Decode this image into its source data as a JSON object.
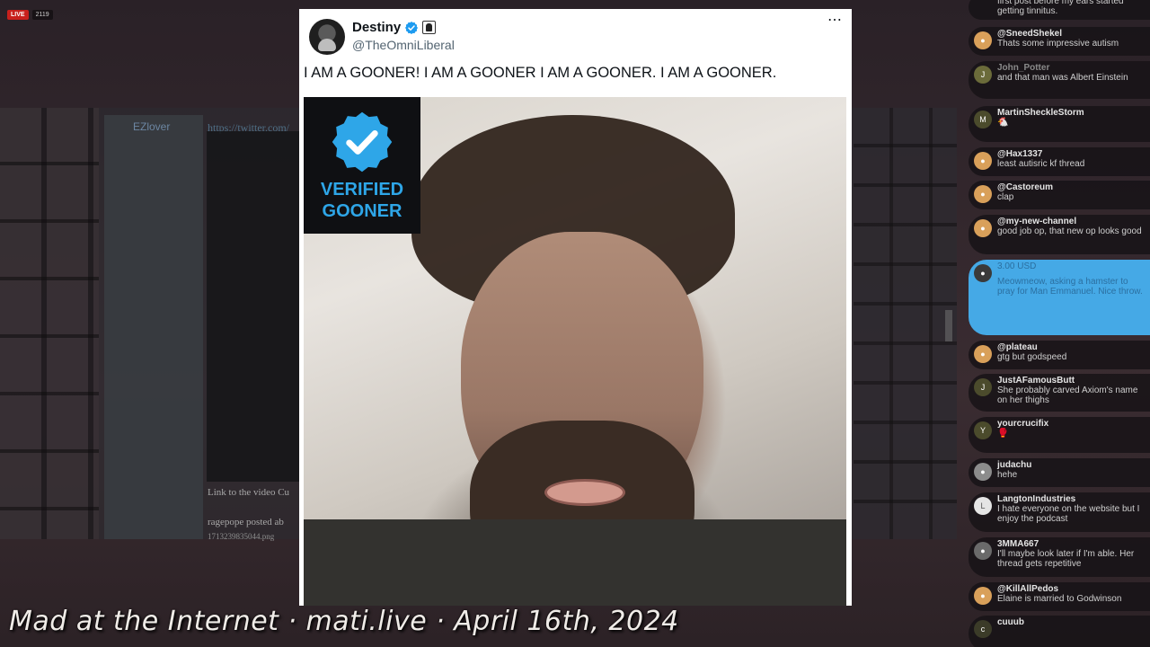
{
  "stream": {
    "live_label": "LIVE",
    "viewer_count": "2119",
    "watermark": "Mad at the Internet · mati.live · April 16th, 2024"
  },
  "background_page": {
    "sidebar_name": "EZlover",
    "url_text": "https://twitter.com/",
    "link_text": "Link to the video Cu",
    "post_text": "ragepope posted ab",
    "file_text": "1713239835044.png"
  },
  "tweet": {
    "display_name": "Destiny",
    "handle": "@TheOmniLiberal",
    "text": "I AM A GOONER! I AM A GOONER I AM A GOONER. I AM A GOONER.",
    "more_icon": "⋯",
    "badge_line1": "VERIFIED",
    "badge_line2": "GOONER",
    "verified_color": "#1d9bf0"
  },
  "chat": {
    "messages": [
      {
        "user": "",
        "body": "first post before my ears started getting tinnitus.",
        "avatar": ""
      },
      {
        "user": "@SneedShekel",
        "body": "Thats some impressive autism",
        "avatar": "●"
      },
      {
        "user": "John_Potter",
        "body": "and that man was Albert Einstein",
        "avatar": "J"
      },
      {
        "user": "MartinSheckleStorm",
        "body": "🐔",
        "avatar": "M"
      },
      {
        "user": "@Hax1337",
        "body": "least autisric kf thread",
        "avatar": "●"
      },
      {
        "user": "@Castoreum",
        "body": "clap",
        "avatar": "●"
      },
      {
        "user": "@my-new-channel",
        "body": "good job op, that new op looks good",
        "avatar": "●"
      },
      {
        "user": "",
        "body": "Meowmeow, asking a hamster to pray for Man Emmanuel. Nice throw.",
        "amount": "3.00 USD",
        "avatar": "●"
      },
      {
        "user": "@plateau",
        "body": "gtg but godspeed",
        "avatar": "●"
      },
      {
        "user": "JustAFamousButt",
        "body": "She probably carved Axiom's name on her thighs",
        "avatar": "J"
      },
      {
        "user": "yourcrucifix",
        "body": "🥊",
        "avatar": "Y"
      },
      {
        "user": "judachu",
        "body": "hehe",
        "avatar": "●"
      },
      {
        "user": "LangtonIndustries",
        "body": "I hate everyone on the website but I enjoy the podcast",
        "avatar": "L"
      },
      {
        "user": "3MMA667",
        "body": "I'll maybe look later if I'm able. Her thread gets repetitive",
        "avatar": "●"
      },
      {
        "user": "@KillAllPedos",
        "body": "Elaine is married to Godwinson",
        "avatar": "●"
      },
      {
        "user": "cuuub",
        "body": "",
        "avatar": "c"
      }
    ]
  }
}
